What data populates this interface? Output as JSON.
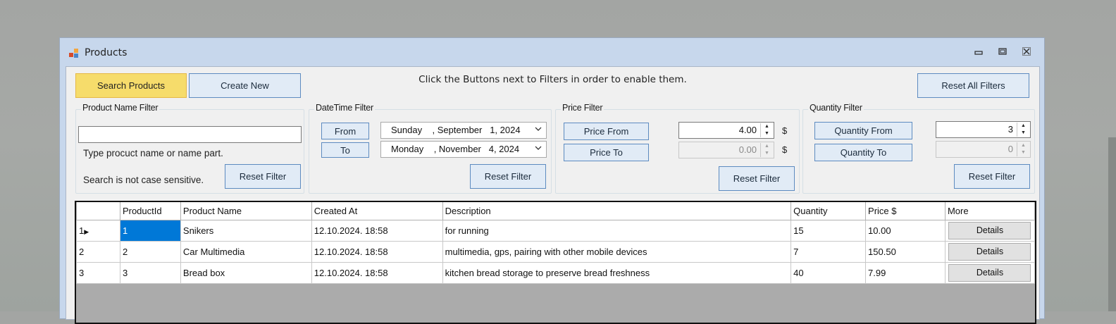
{
  "window": {
    "title": "Products",
    "icon": "app-form-icon"
  },
  "toolbar": {
    "search_label": "Search Products",
    "create_label": "Create New",
    "hint": "Click the Buttons next to Filters in order to enable them.",
    "reset_all_label": "Reset All Filters"
  },
  "name_filter": {
    "title": "Product Name Filter",
    "value": "",
    "help1": "Type procuct name or name part.",
    "help2": "Search is not case sensitive.",
    "reset_label": "Reset Filter"
  },
  "date_filter": {
    "title": "DateTime Filter",
    "from_label": "From",
    "to_label": "To",
    "from_value": "Sunday    , September   1, 2024",
    "to_value": "Monday    , November   4, 2024",
    "reset_label": "Reset Filter"
  },
  "price_filter": {
    "title": "Price Filter",
    "from_label": "Price From",
    "to_label": "Price To",
    "from_value": "4.00",
    "to_value": "0.00",
    "currency": "$",
    "reset_label": "Reset Filter"
  },
  "quantity_filter": {
    "title": "Quantity Filter",
    "from_label": "Quantity From",
    "to_label": "Quantity To",
    "from_value": "3",
    "to_value": "0",
    "reset_label": "Reset Filter"
  },
  "grid": {
    "columns": [
      "",
      "ProductId",
      "Product Name",
      "Created At",
      "Description",
      "Quantity",
      "Price $",
      "More"
    ],
    "rows": [
      {
        "row_header": "1",
        "id": "1",
        "name": "Snikers",
        "created": "12.10.2024. 18:58",
        "description": "for running",
        "quantity": "15",
        "price": "10.00",
        "more": "Details"
      },
      {
        "row_header": "2",
        "id": "2",
        "name": "Car Multimedia",
        "created": "12.10.2024. 18:58",
        "description": "multimedia, gps, pairing with other mobile devices",
        "quantity": "7",
        "price": "150.50",
        "more": "Details"
      },
      {
        "row_header": "3",
        "id": "3",
        "name": "Bread box",
        "created": "12.10.2024. 18:58",
        "description": "kitchen bread storage to preserve bread freshness",
        "quantity": "40",
        "price": "7.99",
        "more": "Details"
      }
    ]
  },
  "colors": {
    "selection": "#0078d7",
    "primary_button": "#f6dc6b",
    "title_bar": "#c7d7ec"
  }
}
